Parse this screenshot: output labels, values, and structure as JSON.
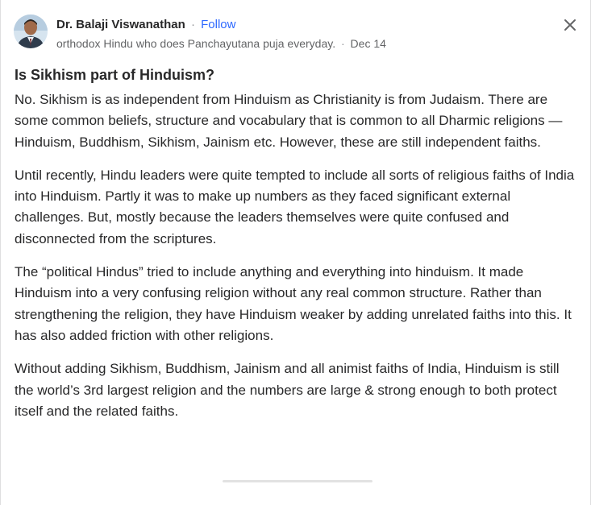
{
  "author": {
    "name": "Dr. Balaji Viswanathan",
    "follow_label": "Follow",
    "separator": "·",
    "credential": "orthodox Hindu who does Panchayutana puja everyday.",
    "date": "Dec 14"
  },
  "question": {
    "title": "Is Sikhism part of Hinduism?"
  },
  "answer": {
    "paragraphs": [
      "No. Sikhism is as independent from Hinduism as Christianity is from Judaism. There are some common beliefs, structure and vocabulary that is common to all Dharmic religions — Hinduism, Buddhism, Sikhism, Jainism etc. However, these are still independent faiths.",
      "Until recently, Hindu leaders were quite tempted to include all sorts of religious faiths of India into Hinduism. Partly it was to make up numbers as they faced significant external challenges. But, mostly because the leaders themselves were quite confused and disconnected from the scriptures.",
      "The “political Hindus” tried to include anything and everything into hinduism. It made Hinduism into a very confusing religion without any real common structure. Rather than strengthening the religion, they have Hinduism weaker by adding unrelated faiths into this. It has also added friction with other religions.",
      "Without adding Sikhism, Buddhism, Jainism and all animist faiths of India, Hinduism is still the world’s 3rd largest religion and the numbers are large & strong enough to both protect itself and the related faiths."
    ]
  },
  "icons": {
    "close": "close-icon",
    "avatar": "avatar"
  },
  "colors": {
    "link": "#2e69ff",
    "text": "#282829",
    "secondary_text": "#636466"
  }
}
